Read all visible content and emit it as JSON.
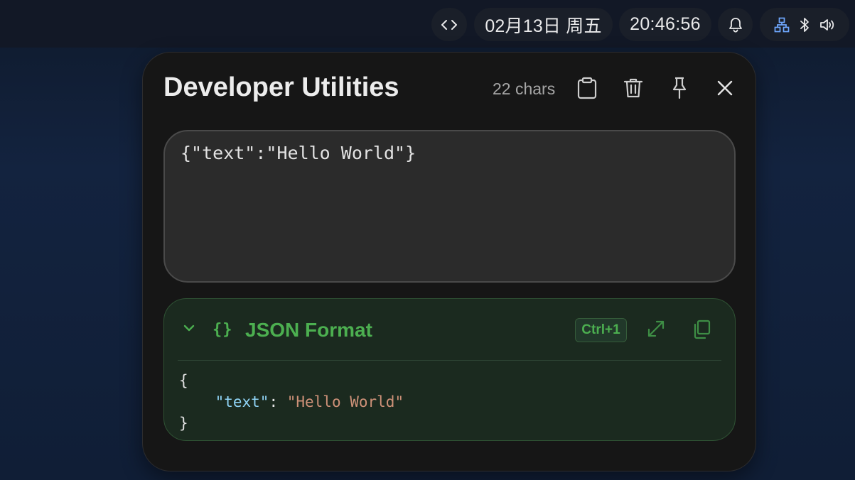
{
  "topbar": {
    "dev_icon": "code-brackets-icon",
    "date": "02月13日 周五",
    "time": "20:46:56",
    "bell_icon": "bell-icon",
    "system_icons": [
      "network-icon",
      "bluetooth-icon",
      "volume-icon"
    ]
  },
  "panel": {
    "title": "Developer Utilities",
    "char_count": "22 chars",
    "header_icons": [
      "clipboard-paste-icon",
      "trash-icon",
      "pin-icon",
      "close-icon"
    ],
    "input_value": "{\"text\":\"Hello World\"}"
  },
  "json_card": {
    "icon": "{}",
    "title": "JSON Format",
    "shortcut": "Ctrl+1",
    "output": {
      "open_brace": "{",
      "indent": "    ",
      "key": "\"text\"",
      "colon": ": ",
      "value": "\"Hello World\"",
      "close_brace": "}"
    }
  },
  "colors": {
    "accent_green": "#4caf50",
    "json_key": "#8fd3f5",
    "json_string": "#ce9178",
    "panel_bg": "#161616",
    "network_icon": "#6fa8ff"
  }
}
